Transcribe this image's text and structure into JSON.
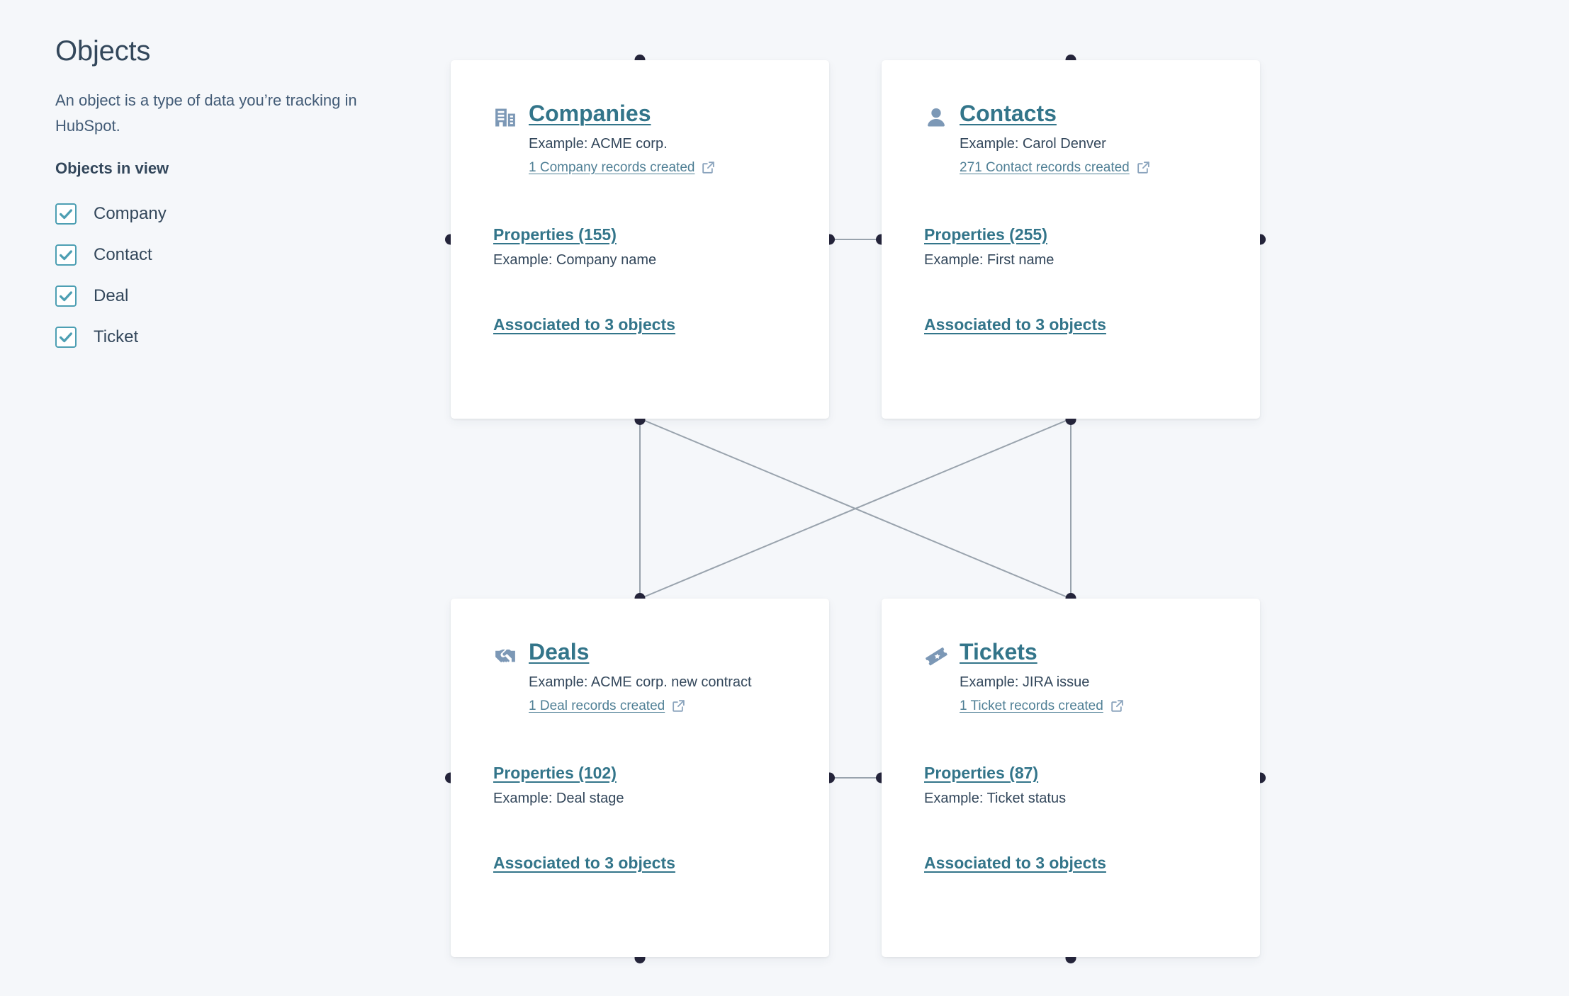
{
  "sidebar": {
    "title": "Objects",
    "description": "An object is a type of data you’re tracking in HubSpot.",
    "section_title": "Objects in view",
    "items": [
      {
        "label": "Company",
        "checked": true
      },
      {
        "label": "Contact",
        "checked": true
      },
      {
        "label": "Deal",
        "checked": true
      },
      {
        "label": "Ticket",
        "checked": true
      }
    ]
  },
  "diagram": {
    "nodes": [
      {
        "id": "companies",
        "title": "Companies",
        "icon": "office-building-icon",
        "example": "Example: ACME corp.",
        "records_link": "1 Company records created",
        "records_link_icon": "external-link-icon",
        "properties_link": "Properties (155)",
        "properties_count": 155,
        "properties_example": "Example: Company name",
        "associations_link": "Associated to 3 objects",
        "associations_count": 3
      },
      {
        "id": "contacts",
        "title": "Contacts",
        "icon": "person-icon",
        "example": "Example: Carol Denver",
        "records_link": "271 Contact records created",
        "records_link_icon": "external-link-icon",
        "properties_link": "Properties (255)",
        "properties_count": 255,
        "properties_example": "Example: First name",
        "associations_link": "Associated to 3 objects",
        "associations_count": 3
      },
      {
        "id": "deals",
        "title": "Deals",
        "icon": "handshake-icon",
        "example": "Example: ACME corp. new contract",
        "records_link": "1 Deal records created",
        "records_link_icon": "external-link-icon",
        "properties_link": "Properties (102)",
        "properties_count": 102,
        "properties_example": "Example: Deal stage",
        "associations_link": "Associated to 3 objects",
        "associations_count": 3
      },
      {
        "id": "tickets",
        "title": "Tickets",
        "icon": "ticket-icon",
        "example": "Example: JIRA issue",
        "records_link": "1 Ticket records created",
        "records_link_icon": "external-link-icon",
        "properties_link": "Properties (87)",
        "properties_count": 87,
        "properties_example": "Example: Ticket status",
        "associations_link": "Associated to 3 objects",
        "associations_count": 3
      }
    ]
  },
  "colors": {
    "background": "#f5f7fa",
    "card": "#ffffff",
    "link": "#33758a",
    "text": "#33475b",
    "icon": "#7c98b6",
    "checkbox_accent": "#4d9fb3",
    "edge": "#99a3ad",
    "anchor": "#24243a"
  }
}
